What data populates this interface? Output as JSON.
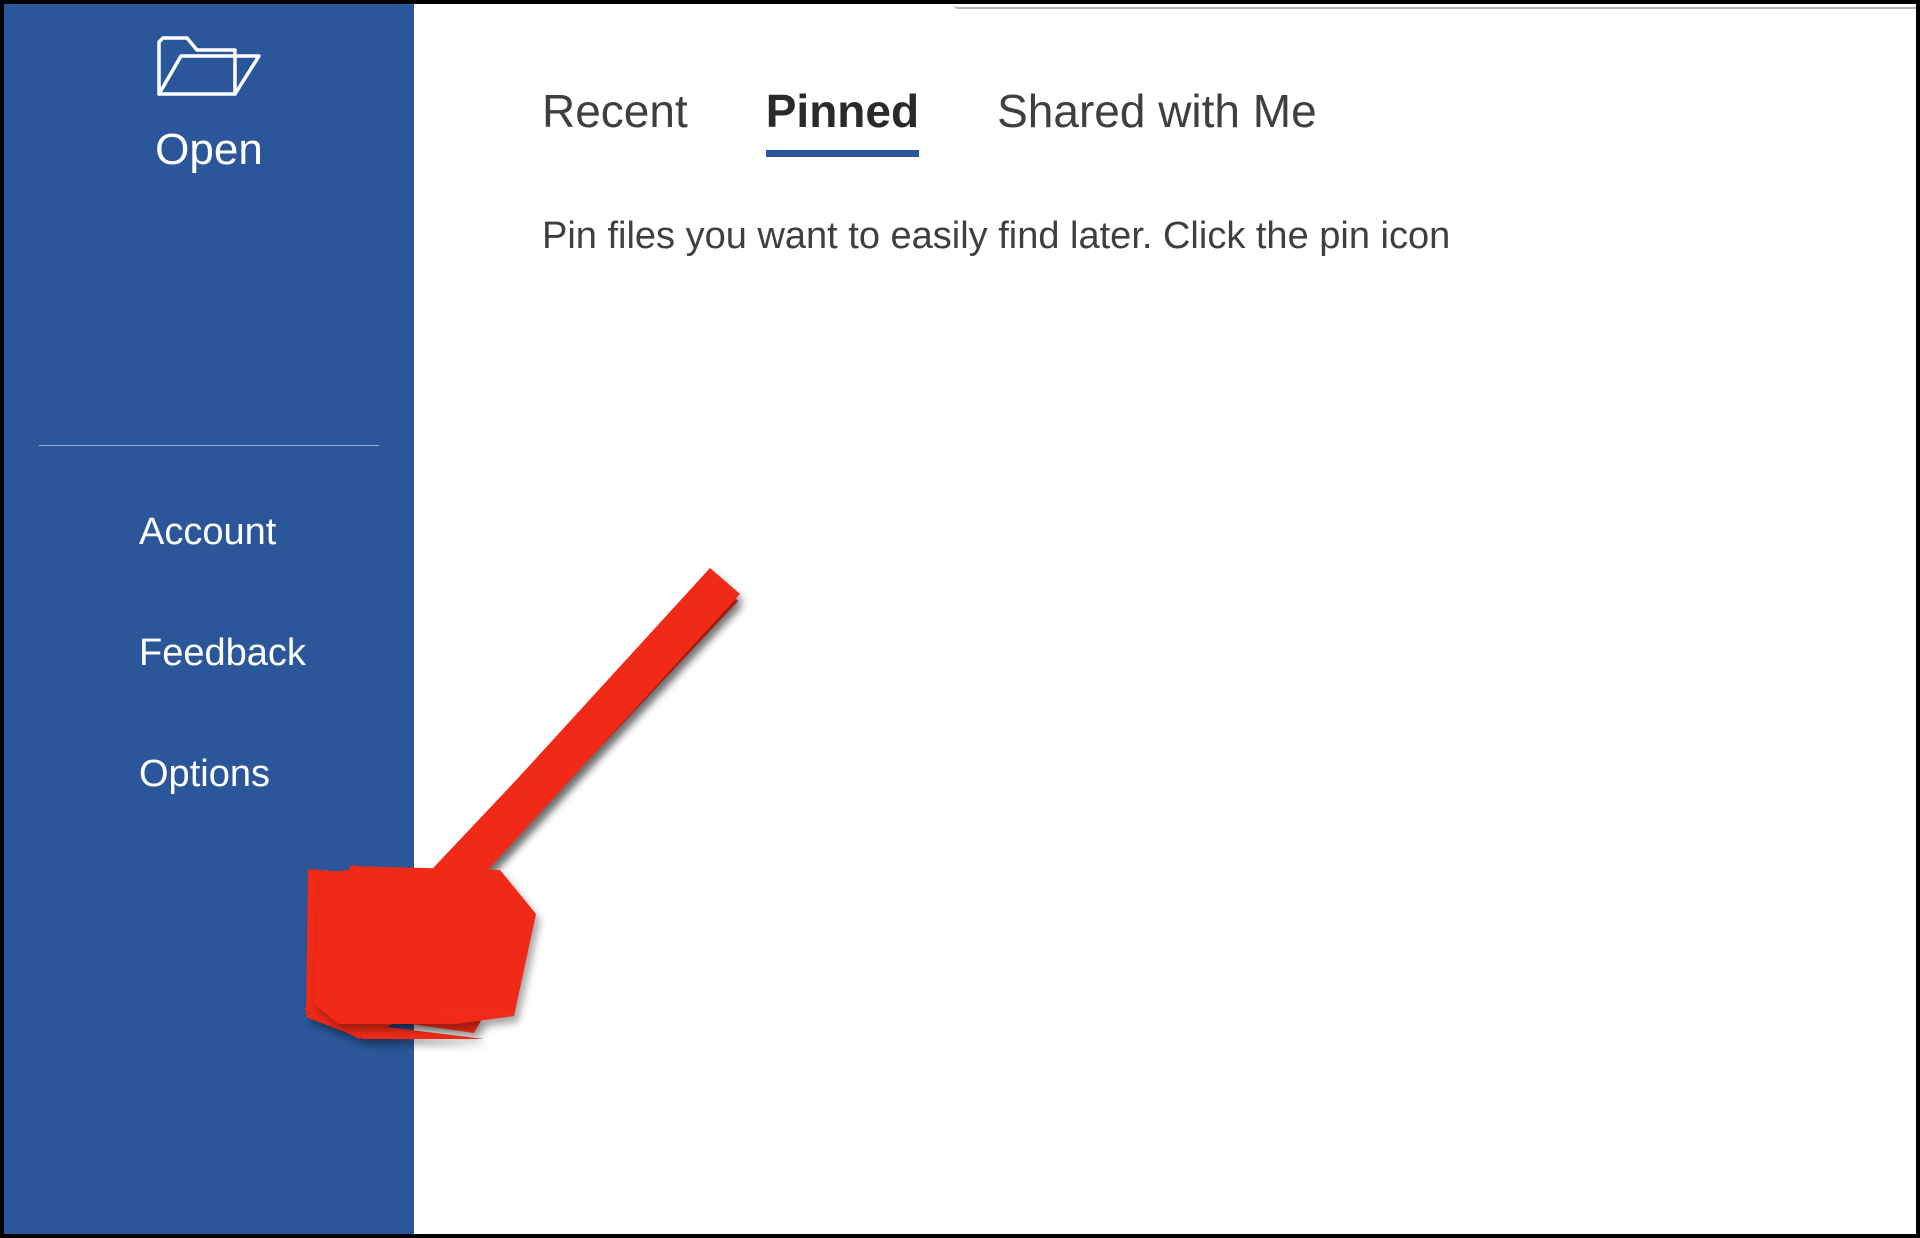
{
  "sidebar": {
    "open_label": "Open",
    "items": {
      "account": "Account",
      "feedback": "Feedback",
      "options": "Options"
    }
  },
  "main": {
    "tabs": {
      "recent": "Recent",
      "pinned": "Pinned",
      "shared": "Shared with Me",
      "active": "pinned"
    },
    "hint": "Pin files you want to easily find later. Click the pin icon"
  },
  "colors": {
    "brand": "#2b579a",
    "arrow": "#f02a17"
  }
}
